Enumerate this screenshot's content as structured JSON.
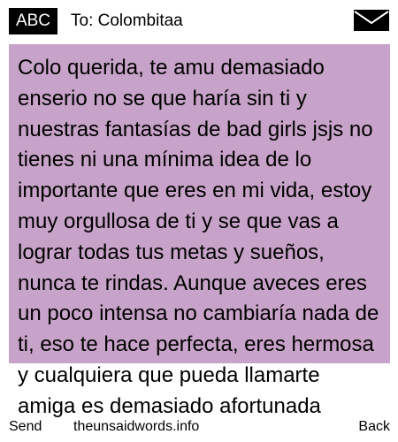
{
  "header": {
    "input_mode": "ABC",
    "recipient": "To: Colombitaa",
    "envelope_icon": "envelope-icon"
  },
  "message": {
    "body": "Colo querida, te amu demasiado enserio no se que haría sin ti y nuestras fantasías de bad girls jsjs no tienes ni una mínima idea de lo importante que eres en mi vida, estoy muy orgullosa de ti y se que vas a lograr todas tus metas y sueños, nunca te rindas. Aunque aveces eres un poco intensa no cambiaría nada de ti, eso te hace perfecta, eres hermosa y cualquiera que pueda llamarte amiga es demasiado afortunada"
  },
  "softkeys": {
    "left": "Send",
    "center": "theunsaidwords.info",
    "right": "Back"
  },
  "colors": {
    "highlight": "#c8a3c9",
    "badge": "#000000"
  }
}
